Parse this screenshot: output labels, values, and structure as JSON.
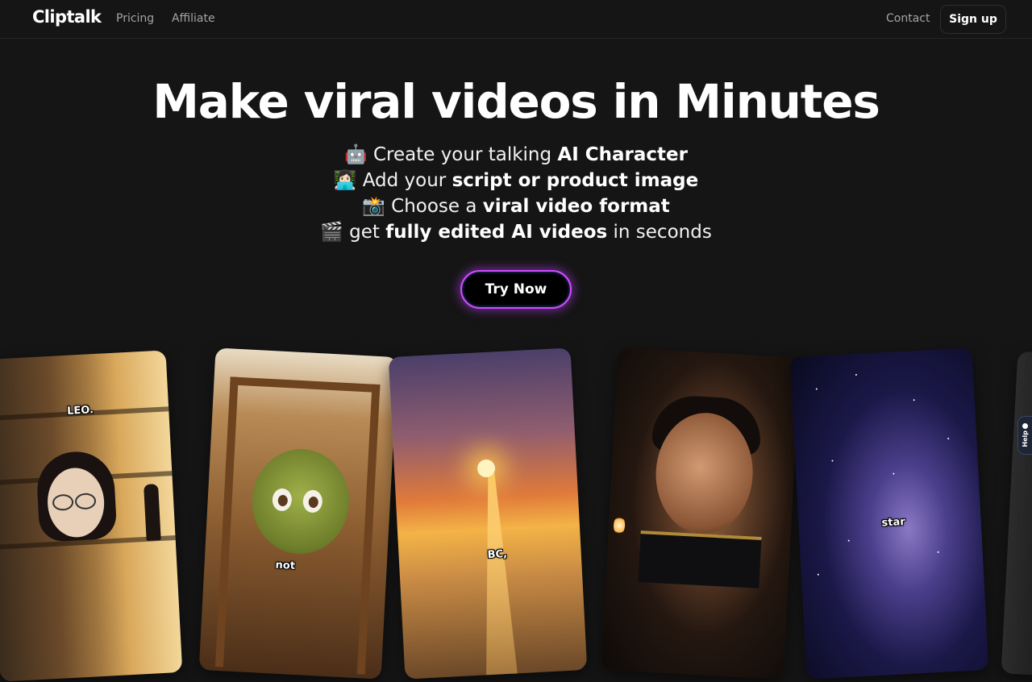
{
  "header": {
    "logo": "Cliptalk",
    "nav": {
      "pricing": "Pricing",
      "affiliate": "Affiliate",
      "contact": "Contact"
    },
    "signup_label": "Sign up"
  },
  "hero": {
    "headline": "Make viral videos in Minutes",
    "features": [
      {
        "emoji": "🤖",
        "pre": "Create your talking",
        "bold": "AI Character",
        "post": ""
      },
      {
        "emoji": "👩🏻‍💻",
        "pre": "Add your",
        "bold": "script or product image",
        "post": ""
      },
      {
        "emoji": "📸",
        "pre": "Choose a",
        "bold": "viral video format",
        "post": ""
      },
      {
        "emoji": "🎬",
        "pre": "get",
        "bold": "fully edited AI videos",
        "post": "in seconds"
      }
    ],
    "cta_label": "Try Now"
  },
  "cards": [
    {
      "caption": "LEO."
    },
    {
      "caption": "not"
    },
    {
      "caption": "BC,"
    },
    {
      "caption": ""
    },
    {
      "caption": "star"
    }
  ],
  "help": {
    "label": "Help"
  },
  "colors": {
    "background": "#151515",
    "cta_border": "#d14bff",
    "help_tab": "#1e2535"
  }
}
